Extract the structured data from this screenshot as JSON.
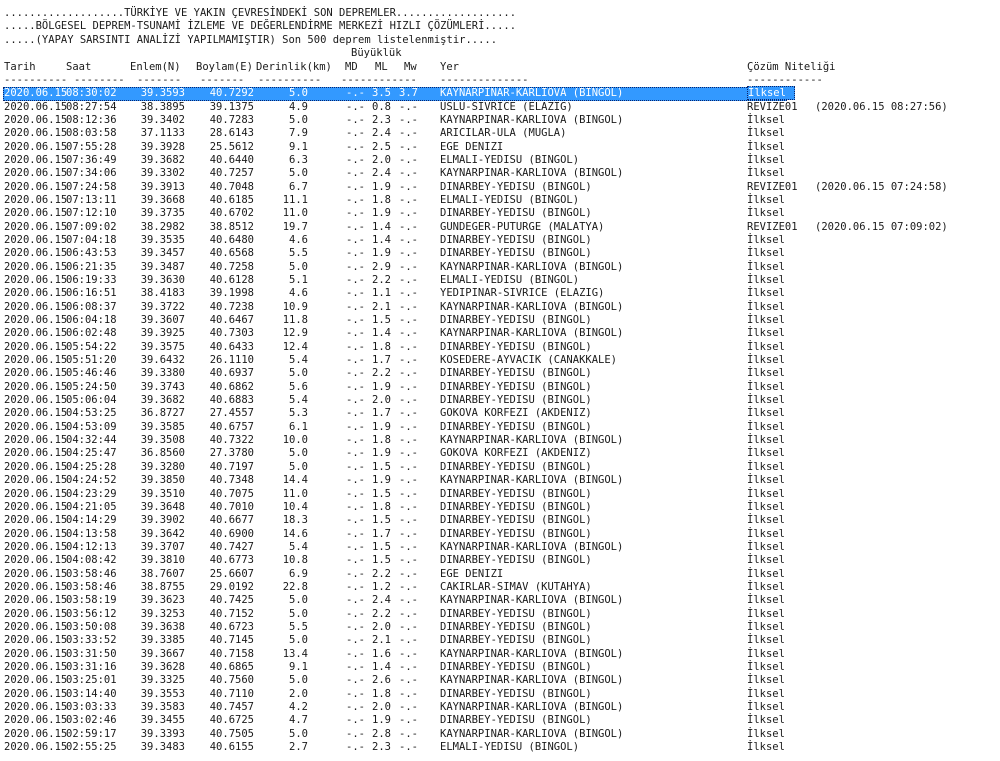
{
  "header": {
    "line1": "...................TÜRKİYE VE YAKIN ÇEVRESİNDEKİ SON DEPREMLER...................",
    "line2": ".....BÖLGESEL DEPREM-TSUNAMİ İZLEME VE DEĞERLENDİRME MERKEZİ HIZLI ÇÖZÜMLERİ.....",
    "line3": ".....(YAPAY SARSINTI ANALİZİ YAPILMAMIŞTIR) Son 500 deprem listelenmiştir....."
  },
  "columns": {
    "group": "Büyüklük",
    "date": "Tarih",
    "time": "Saat",
    "lat": "Enlem(N)",
    "lon": "Boylam(E)",
    "depth": "Derinlik(km)",
    "md": "MD",
    "ml": "ML",
    "mw": "Mw",
    "place": "Yer",
    "type": "Çözüm Niteliği"
  },
  "dashes": {
    "date": "----------",
    "time": "--------",
    "lat": "-------",
    "lon": "-------",
    "depth": "----------",
    "mag": "------------",
    "place": "--------------",
    "type": "------------"
  },
  "rows": [
    {
      "date": "2020.06.15",
      "time": "08:30:02",
      "lat": "39.3593",
      "lon": "40.7292",
      "depth": "5.0",
      "md": "-.-",
      "ml": "3.5",
      "mw": "3.7",
      "place": "KAYNARPINAR-KARLIOVA (BINGOL)",
      "type": "İlksel",
      "rev": ""
    },
    {
      "date": "2020.06.15",
      "time": "08:27:54",
      "lat": "38.3895",
      "lon": "39.1375",
      "depth": "4.9",
      "md": "-.-",
      "ml": "0.8",
      "mw": "-.-",
      "place": "USLU-SIVRICE (ELAZIG)",
      "type": "REVIZE01",
      "rev": "(2020.06.15 08:27:56)"
    },
    {
      "date": "2020.06.15",
      "time": "08:12:36",
      "lat": "39.3402",
      "lon": "40.7283",
      "depth": "5.0",
      "md": "-.-",
      "ml": "2.3",
      "mw": "-.-",
      "place": "KAYNARPINAR-KARLIOVA (BINGOL)",
      "type": "İlksel",
      "rev": ""
    },
    {
      "date": "2020.06.15",
      "time": "08:03:58",
      "lat": "37.1133",
      "lon": "28.6143",
      "depth": "7.9",
      "md": "-.-",
      "ml": "2.4",
      "mw": "-.-",
      "place": "ARICILAR-ULA (MUGLA)",
      "type": "İlksel",
      "rev": ""
    },
    {
      "date": "2020.06.15",
      "time": "07:55:28",
      "lat": "39.3928",
      "lon": "25.5612",
      "depth": "9.1",
      "md": "-.-",
      "ml": "2.5",
      "mw": "-.-",
      "place": "EGE DENIZI",
      "type": "İlksel",
      "rev": ""
    },
    {
      "date": "2020.06.15",
      "time": "07:36:49",
      "lat": "39.3682",
      "lon": "40.6440",
      "depth": "6.3",
      "md": "-.-",
      "ml": "2.0",
      "mw": "-.-",
      "place": "ELMALI-YEDISU (BINGOL)",
      "type": "İlksel",
      "rev": ""
    },
    {
      "date": "2020.06.15",
      "time": "07:34:06",
      "lat": "39.3302",
      "lon": "40.7257",
      "depth": "5.0",
      "md": "-.-",
      "ml": "2.4",
      "mw": "-.-",
      "place": "KAYNARPINAR-KARLIOVA (BINGOL)",
      "type": "İlksel",
      "rev": ""
    },
    {
      "date": "2020.06.15",
      "time": "07:24:58",
      "lat": "39.3913",
      "lon": "40.7048",
      "depth": "6.7",
      "md": "-.-",
      "ml": "1.9",
      "mw": "-.-",
      "place": "DINARBEY-YEDISU (BINGOL)",
      "type": "REVIZE01",
      "rev": "(2020.06.15 07:24:58)"
    },
    {
      "date": "2020.06.15",
      "time": "07:13:11",
      "lat": "39.3668",
      "lon": "40.6185",
      "depth": "11.1",
      "md": "-.-",
      "ml": "1.8",
      "mw": "-.-",
      "place": "ELMALI-YEDISU (BINGOL)",
      "type": "İlksel",
      "rev": ""
    },
    {
      "date": "2020.06.15",
      "time": "07:12:10",
      "lat": "39.3735",
      "lon": "40.6702",
      "depth": "11.0",
      "md": "-.-",
      "ml": "1.9",
      "mw": "-.-",
      "place": "DINARBEY-YEDISU (BINGOL)",
      "type": "İlksel",
      "rev": ""
    },
    {
      "date": "2020.06.15",
      "time": "07:09:02",
      "lat": "38.2982",
      "lon": "38.8512",
      "depth": "19.7",
      "md": "-.-",
      "ml": "1.4",
      "mw": "-.-",
      "place": "GUNDEGER-PUTURGE (MALATYA)",
      "type": "REVIZE01",
      "rev": "(2020.06.15 07:09:02)"
    },
    {
      "date": "2020.06.15",
      "time": "07:04:18",
      "lat": "39.3535",
      "lon": "40.6480",
      "depth": "4.6",
      "md": "-.-",
      "ml": "1.4",
      "mw": "-.-",
      "place": "DINARBEY-YEDISU (BINGOL)",
      "type": "İlksel",
      "rev": ""
    },
    {
      "date": "2020.06.15",
      "time": "06:43:53",
      "lat": "39.3457",
      "lon": "40.6568",
      "depth": "5.5",
      "md": "-.-",
      "ml": "1.9",
      "mw": "-.-",
      "place": "DINARBEY-YEDISU (BINGOL)",
      "type": "İlksel",
      "rev": ""
    },
    {
      "date": "2020.06.15",
      "time": "06:21:35",
      "lat": "39.3487",
      "lon": "40.7258",
      "depth": "5.0",
      "md": "-.-",
      "ml": "2.9",
      "mw": "-.-",
      "place": "KAYNARPINAR-KARLIOVA (BINGOL)",
      "type": "İlksel",
      "rev": ""
    },
    {
      "date": "2020.06.15",
      "time": "06:19:33",
      "lat": "39.3630",
      "lon": "40.6128",
      "depth": "5.1",
      "md": "-.-",
      "ml": "2.2",
      "mw": "-.-",
      "place": "ELMALI-YEDISU (BINGOL)",
      "type": "İlksel",
      "rev": ""
    },
    {
      "date": "2020.06.15",
      "time": "06:16:51",
      "lat": "38.4183",
      "lon": "39.1998",
      "depth": "4.6",
      "md": "-.-",
      "ml": "1.1",
      "mw": "-.-",
      "place": "YEDIPINAR-SIVRICE (ELAZIG)",
      "type": "İlksel",
      "rev": ""
    },
    {
      "date": "2020.06.15",
      "time": "06:08:37",
      "lat": "39.3722",
      "lon": "40.7238",
      "depth": "10.9",
      "md": "-.-",
      "ml": "2.1",
      "mw": "-.-",
      "place": "KAYNARPINAR-KARLIOVA (BINGOL)",
      "type": "İlksel",
      "rev": ""
    },
    {
      "date": "2020.06.15",
      "time": "06:04:18",
      "lat": "39.3607",
      "lon": "40.6467",
      "depth": "11.8",
      "md": "-.-",
      "ml": "1.5",
      "mw": "-.-",
      "place": "DINARBEY-YEDISU (BINGOL)",
      "type": "İlksel",
      "rev": ""
    },
    {
      "date": "2020.06.15",
      "time": "06:02:48",
      "lat": "39.3925",
      "lon": "40.7303",
      "depth": "12.9",
      "md": "-.-",
      "ml": "1.4",
      "mw": "-.-",
      "place": "KAYNARPINAR-KARLIOVA (BINGOL)",
      "type": "İlksel",
      "rev": ""
    },
    {
      "date": "2020.06.15",
      "time": "05:54:22",
      "lat": "39.3575",
      "lon": "40.6433",
      "depth": "12.4",
      "md": "-.-",
      "ml": "1.8",
      "mw": "-.-",
      "place": "DINARBEY-YEDISU (BINGOL)",
      "type": "İlksel",
      "rev": ""
    },
    {
      "date": "2020.06.15",
      "time": "05:51:20",
      "lat": "39.6432",
      "lon": "26.1110",
      "depth": "5.4",
      "md": "-.-",
      "ml": "1.7",
      "mw": "-.-",
      "place": "KOSEDERE-AYVACIK (CANAKKALE)",
      "type": "İlksel",
      "rev": ""
    },
    {
      "date": "2020.06.15",
      "time": "05:46:46",
      "lat": "39.3380",
      "lon": "40.6937",
      "depth": "5.0",
      "md": "-.-",
      "ml": "2.2",
      "mw": "-.-",
      "place": "DINARBEY-YEDISU (BINGOL)",
      "type": "İlksel",
      "rev": ""
    },
    {
      "date": "2020.06.15",
      "time": "05:24:50",
      "lat": "39.3743",
      "lon": "40.6862",
      "depth": "5.6",
      "md": "-.-",
      "ml": "1.9",
      "mw": "-.-",
      "place": "DINARBEY-YEDISU (BINGOL)",
      "type": "İlksel",
      "rev": ""
    },
    {
      "date": "2020.06.15",
      "time": "05:06:04",
      "lat": "39.3682",
      "lon": "40.6883",
      "depth": "5.4",
      "md": "-.-",
      "ml": "2.0",
      "mw": "-.-",
      "place": "DINARBEY-YEDISU (BINGOL)",
      "type": "İlksel",
      "rev": ""
    },
    {
      "date": "2020.06.15",
      "time": "04:53:25",
      "lat": "36.8727",
      "lon": "27.4557",
      "depth": "5.3",
      "md": "-.-",
      "ml": "1.7",
      "mw": "-.-",
      "place": "GOKOVA KORFEZI (AKDENIZ)",
      "type": "İlksel",
      "rev": ""
    },
    {
      "date": "2020.06.15",
      "time": "04:53:09",
      "lat": "39.3585",
      "lon": "40.6757",
      "depth": "6.1",
      "md": "-.-",
      "ml": "1.9",
      "mw": "-.-",
      "place": "DINARBEY-YEDISU (BINGOL)",
      "type": "İlksel",
      "rev": ""
    },
    {
      "date": "2020.06.15",
      "time": "04:32:44",
      "lat": "39.3508",
      "lon": "40.7322",
      "depth": "10.0",
      "md": "-.-",
      "ml": "1.8",
      "mw": "-.-",
      "place": "KAYNARPINAR-KARLIOVA (BINGOL)",
      "type": "İlksel",
      "rev": ""
    },
    {
      "date": "2020.06.15",
      "time": "04:25:47",
      "lat": "36.8560",
      "lon": "27.3780",
      "depth": "5.0",
      "md": "-.-",
      "ml": "1.9",
      "mw": "-.-",
      "place": "GOKOVA KORFEZI (AKDENIZ)",
      "type": "İlksel",
      "rev": ""
    },
    {
      "date": "2020.06.15",
      "time": "04:25:28",
      "lat": "39.3280",
      "lon": "40.7197",
      "depth": "5.0",
      "md": "-.-",
      "ml": "1.5",
      "mw": "-.-",
      "place": "DINARBEY-YEDISU (BINGOL)",
      "type": "İlksel",
      "rev": ""
    },
    {
      "date": "2020.06.15",
      "time": "04:24:52",
      "lat": "39.3850",
      "lon": "40.7348",
      "depth": "14.4",
      "md": "-.-",
      "ml": "1.9",
      "mw": "-.-",
      "place": "KAYNARPINAR-KARLIOVA (BINGOL)",
      "type": "İlksel",
      "rev": ""
    },
    {
      "date": "2020.06.15",
      "time": "04:23:29",
      "lat": "39.3510",
      "lon": "40.7075",
      "depth": "11.0",
      "md": "-.-",
      "ml": "1.5",
      "mw": "-.-",
      "place": "DINARBEY-YEDISU (BINGOL)",
      "type": "İlksel",
      "rev": ""
    },
    {
      "date": "2020.06.15",
      "time": "04:21:05",
      "lat": "39.3648",
      "lon": "40.7010",
      "depth": "10.4",
      "md": "-.-",
      "ml": "1.8",
      "mw": "-.-",
      "place": "DINARBEY-YEDISU (BINGOL)",
      "type": "İlksel",
      "rev": ""
    },
    {
      "date": "2020.06.15",
      "time": "04:14:29",
      "lat": "39.3902",
      "lon": "40.6677",
      "depth": "18.3",
      "md": "-.-",
      "ml": "1.5",
      "mw": "-.-",
      "place": "DINARBEY-YEDISU (BINGOL)",
      "type": "İlksel",
      "rev": ""
    },
    {
      "date": "2020.06.15",
      "time": "04:13:58",
      "lat": "39.3642",
      "lon": "40.6900",
      "depth": "14.6",
      "md": "-.-",
      "ml": "1.7",
      "mw": "-.-",
      "place": "DINARBEY-YEDISU (BINGOL)",
      "type": "İlksel",
      "rev": ""
    },
    {
      "date": "2020.06.15",
      "time": "04:12:13",
      "lat": "39.3707",
      "lon": "40.7427",
      "depth": "5.4",
      "md": "-.-",
      "ml": "1.5",
      "mw": "-.-",
      "place": "KAYNARPINAR-KARLIOVA (BINGOL)",
      "type": "İlksel",
      "rev": ""
    },
    {
      "date": "2020.06.15",
      "time": "04:08:42",
      "lat": "39.3810",
      "lon": "40.6773",
      "depth": "10.8",
      "md": "-.-",
      "ml": "1.5",
      "mw": "-.-",
      "place": "DINARBEY-YEDISU (BINGOL)",
      "type": "İlksel",
      "rev": ""
    },
    {
      "date": "2020.06.15",
      "time": "03:58:46",
      "lat": "38.7607",
      "lon": "25.6607",
      "depth": "6.9",
      "md": "-.-",
      "ml": "2.2",
      "mw": "-.-",
      "place": "EGE DENIZI",
      "type": "İlksel",
      "rev": ""
    },
    {
      "date": "2020.06.15",
      "time": "03:58:46",
      "lat": "38.8755",
      "lon": "29.0192",
      "depth": "22.8",
      "md": "-.-",
      "ml": "1.2",
      "mw": "-.-",
      "place": "CAKIRLAR-SIMAV (KUTAHYA)",
      "type": "İlksel",
      "rev": ""
    },
    {
      "date": "2020.06.15",
      "time": "03:58:19",
      "lat": "39.3623",
      "lon": "40.7425",
      "depth": "5.0",
      "md": "-.-",
      "ml": "2.4",
      "mw": "-.-",
      "place": "KAYNARPINAR-KARLIOVA (BINGOL)",
      "type": "İlksel",
      "rev": ""
    },
    {
      "date": "2020.06.15",
      "time": "03:56:12",
      "lat": "39.3253",
      "lon": "40.7152",
      "depth": "5.0",
      "md": "-.-",
      "ml": "2.2",
      "mw": "-.-",
      "place": "DINARBEY-YEDISU (BINGOL)",
      "type": "İlksel",
      "rev": ""
    },
    {
      "date": "2020.06.15",
      "time": "03:50:08",
      "lat": "39.3638",
      "lon": "40.6723",
      "depth": "5.5",
      "md": "-.-",
      "ml": "2.0",
      "mw": "-.-",
      "place": "DINARBEY-YEDISU (BINGOL)",
      "type": "İlksel",
      "rev": ""
    },
    {
      "date": "2020.06.15",
      "time": "03:33:52",
      "lat": "39.3385",
      "lon": "40.7145",
      "depth": "5.0",
      "md": "-.-",
      "ml": "2.1",
      "mw": "-.-",
      "place": "DINARBEY-YEDISU (BINGOL)",
      "type": "İlksel",
      "rev": ""
    },
    {
      "date": "2020.06.15",
      "time": "03:31:50",
      "lat": "39.3667",
      "lon": "40.7158",
      "depth": "13.4",
      "md": "-.-",
      "ml": "1.6",
      "mw": "-.-",
      "place": "KAYNARPINAR-KARLIOVA (BINGOL)",
      "type": "İlksel",
      "rev": ""
    },
    {
      "date": "2020.06.15",
      "time": "03:31:16",
      "lat": "39.3628",
      "lon": "40.6865",
      "depth": "9.1",
      "md": "-.-",
      "ml": "1.4",
      "mw": "-.-",
      "place": "DINARBEY-YEDISU (BINGOL)",
      "type": "İlksel",
      "rev": ""
    },
    {
      "date": "2020.06.15",
      "time": "03:25:01",
      "lat": "39.3325",
      "lon": "40.7560",
      "depth": "5.0",
      "md": "-.-",
      "ml": "2.6",
      "mw": "-.-",
      "place": "KAYNARPINAR-KARLIOVA (BINGOL)",
      "type": "İlksel",
      "rev": ""
    },
    {
      "date": "2020.06.15",
      "time": "03:14:40",
      "lat": "39.3553",
      "lon": "40.7110",
      "depth": "2.0",
      "md": "-.-",
      "ml": "1.8",
      "mw": "-.-",
      "place": "DINARBEY-YEDISU (BINGOL)",
      "type": "İlksel",
      "rev": ""
    },
    {
      "date": "2020.06.15",
      "time": "03:03:33",
      "lat": "39.3583",
      "lon": "40.7457",
      "depth": "4.2",
      "md": "-.-",
      "ml": "2.0",
      "mw": "-.-",
      "place": "KAYNARPINAR-KARLIOVA (BINGOL)",
      "type": "İlksel",
      "rev": ""
    },
    {
      "date": "2020.06.15",
      "time": "03:02:46",
      "lat": "39.3455",
      "lon": "40.6725",
      "depth": "4.7",
      "md": "-.-",
      "ml": "1.9",
      "mw": "-.-",
      "place": "DINARBEY-YEDISU (BINGOL)",
      "type": "İlksel",
      "rev": ""
    },
    {
      "date": "2020.06.15",
      "time": "02:59:17",
      "lat": "39.3393",
      "lon": "40.7505",
      "depth": "5.0",
      "md": "-.-",
      "ml": "2.8",
      "mw": "-.-",
      "place": "KAYNARPINAR-KARLIOVA (BINGOL)",
      "type": "İlksel",
      "rev": ""
    },
    {
      "date": "2020.06.15",
      "time": "02:55:25",
      "lat": "39.3483",
      "lon": "40.6155",
      "depth": "2.7",
      "md": "-.-",
      "ml": "2.3",
      "mw": "-.-",
      "place": "ELMALI-YEDISU (BINGOL)",
      "type": "İlksel",
      "rev": ""
    }
  ]
}
